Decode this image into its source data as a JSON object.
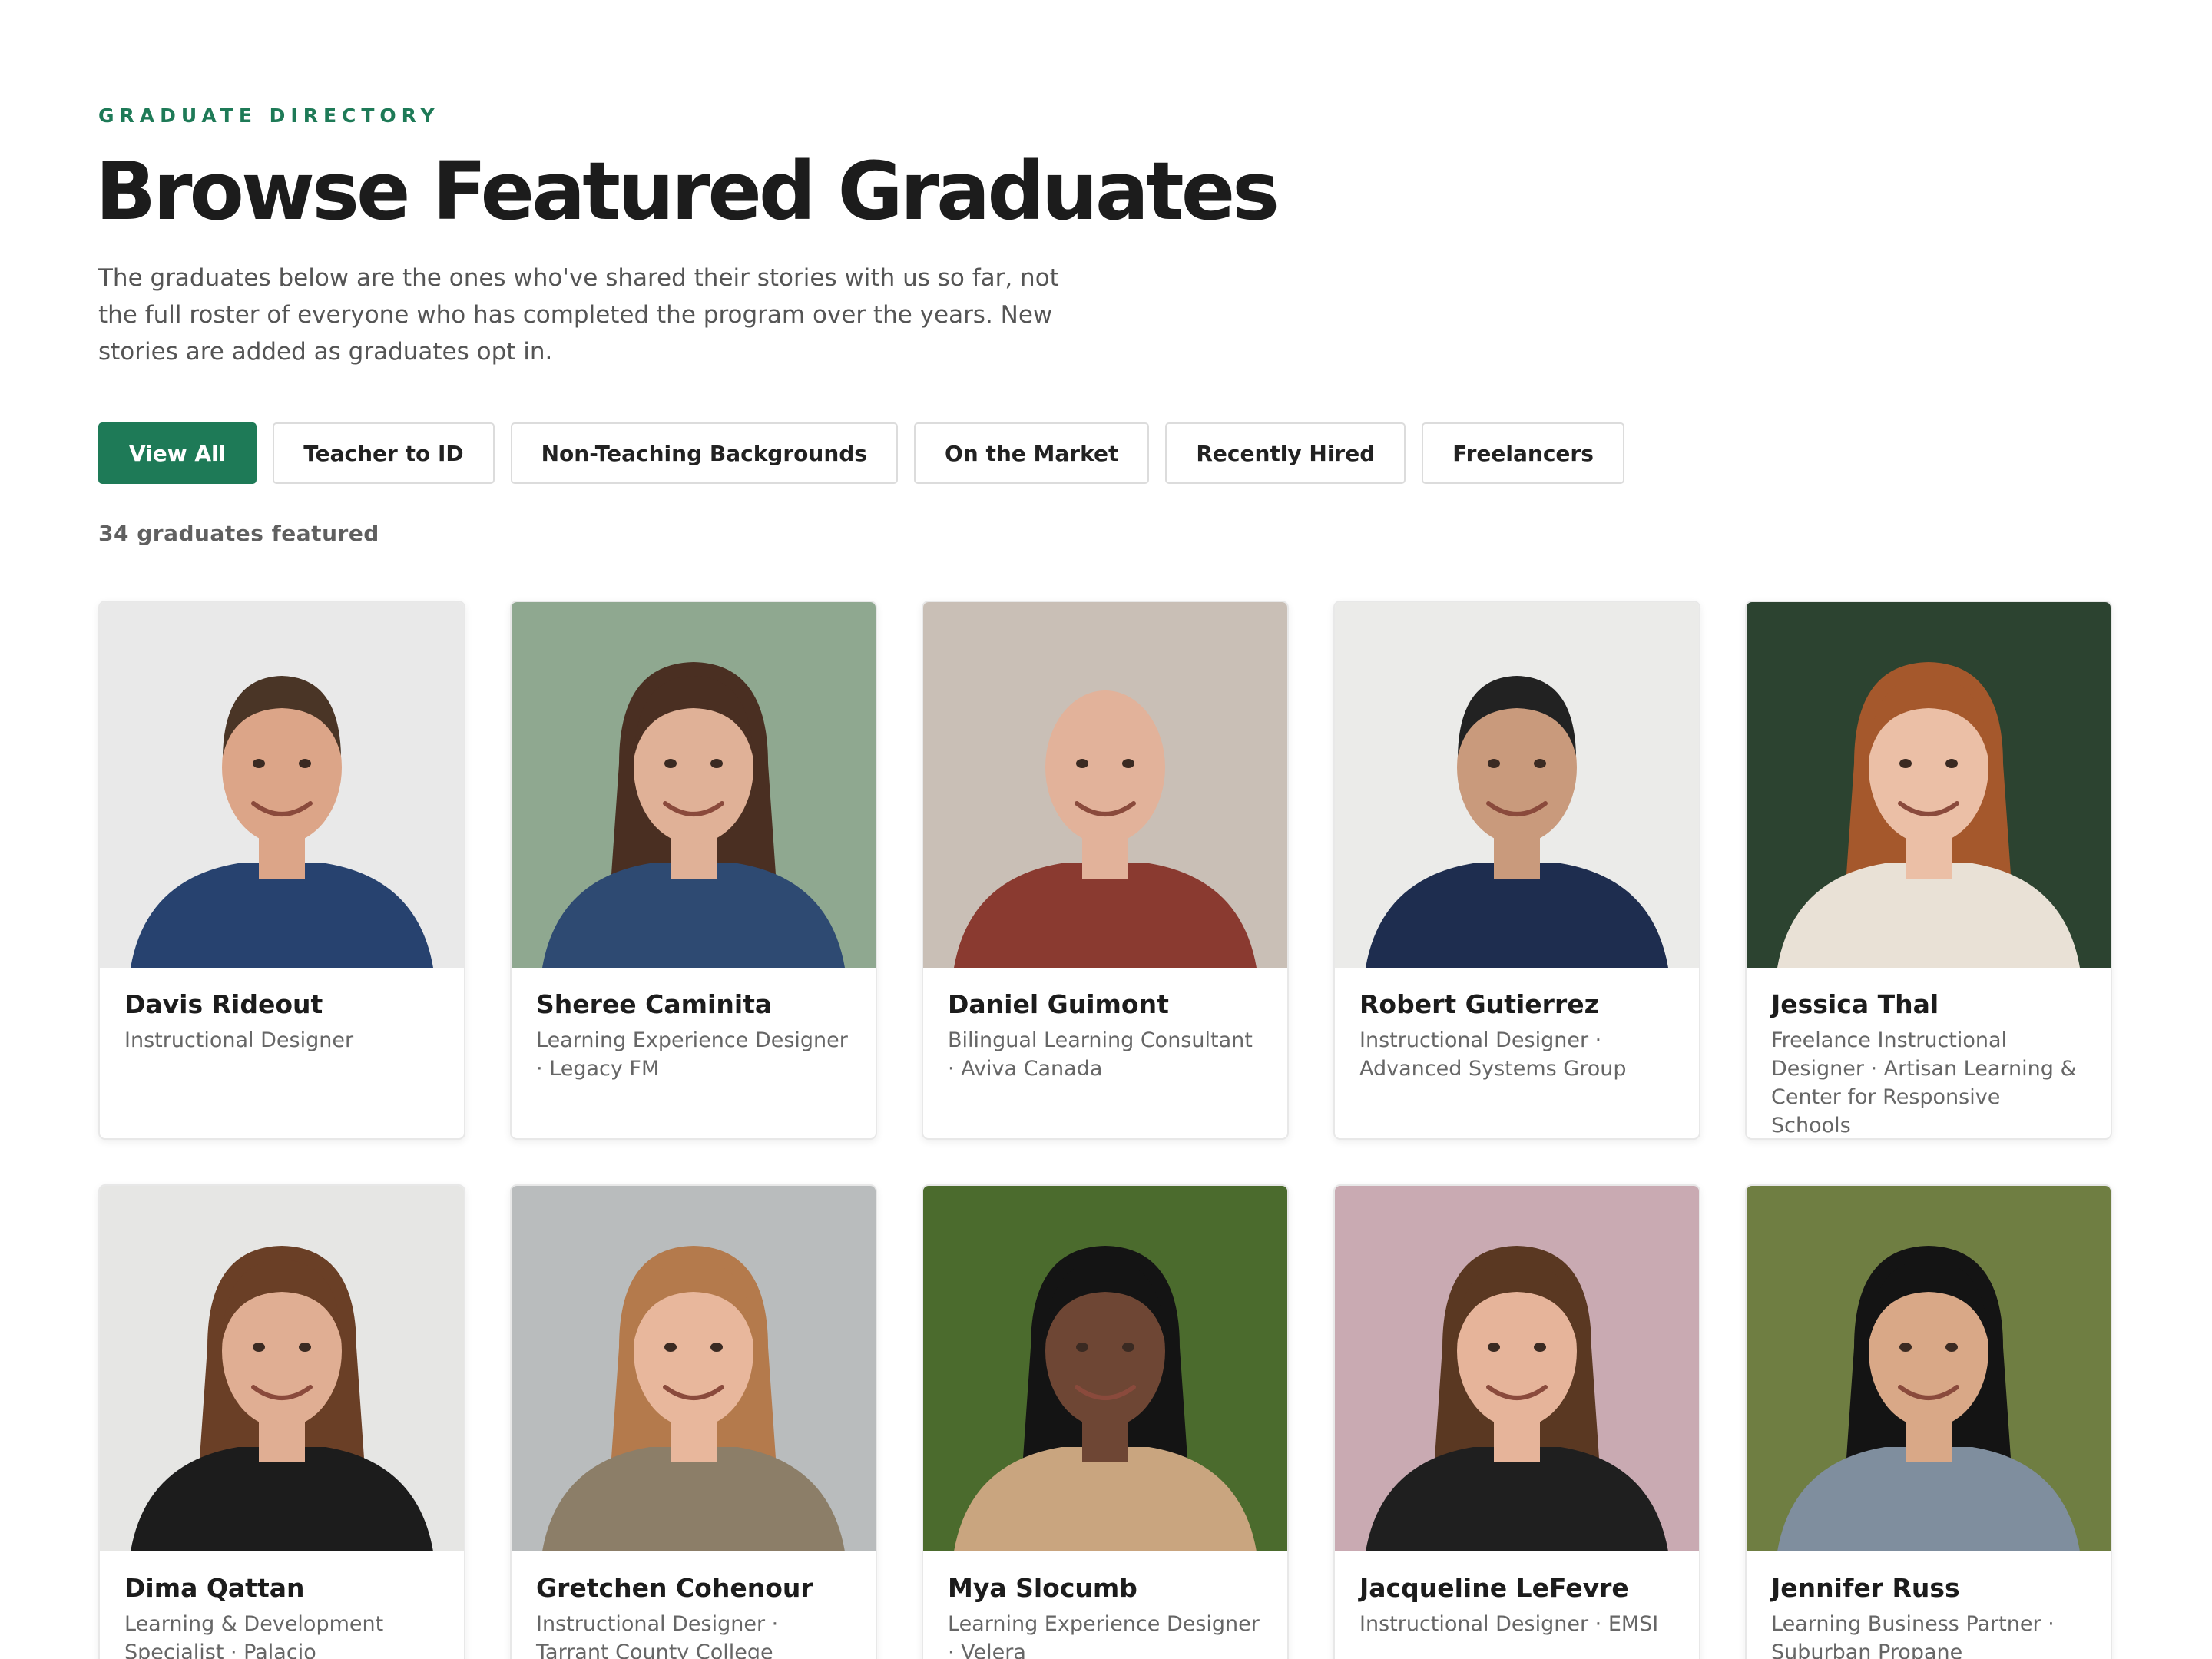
{
  "header": {
    "eyebrow": "GRADUATE DIRECTORY",
    "title": "Browse Featured Graduates",
    "intro": "The graduates below are the ones who've shared their stories with us so far, not the full roster of everyone who has completed the program over the years. New stories are added as graduates opt in."
  },
  "filters": [
    {
      "label": "View All",
      "active": true
    },
    {
      "label": "Teacher to ID",
      "active": false
    },
    {
      "label": "Non-Teaching Backgrounds",
      "active": false
    },
    {
      "label": "On the Market",
      "active": false
    },
    {
      "label": "Recently Hired",
      "active": false
    },
    {
      "label": "Freelancers",
      "active": false
    }
  ],
  "count_label": "34 graduates featured",
  "colors": {
    "accent": "#1e7a57"
  },
  "graduates": [
    {
      "name": "Davis Rideout",
      "role": "Instructional Designer",
      "bg": "#e9e9e9",
      "skin": "#dca588",
      "hair": "#4a3526",
      "shirt": "#27426f",
      "hair_style": "short"
    },
    {
      "name": "Sheree Caminita",
      "role": "Learning Experience Designer · Legacy FM",
      "bg": "#8fa890",
      "skin": "#e0b197",
      "hair": "#4a2f22",
      "shirt": "#2e4a72",
      "hair_style": "long"
    },
    {
      "name": "Daniel Guimont",
      "role": "Bilingual Learning Consultant · Aviva Canada",
      "bg": "#c9bfb6",
      "skin": "#e2b29a",
      "hair": "#d8a991",
      "shirt": "#8a3a30",
      "hair_style": "bald"
    },
    {
      "name": "Robert Gutierrez",
      "role": "Instructional Designer · Advanced Systems Group",
      "bg": "#ebebe9",
      "skin": "#c99a7c",
      "hair": "#222222",
      "shirt": "#1e2d4f",
      "hair_style": "short"
    },
    {
      "name": "Jessica Thal",
      "role": "Freelance Instructional Designer · Artisan Learning & Center for Responsive Schools",
      "bg": "#2c4330",
      "skin": "#ebbfa6",
      "hair": "#a5582c",
      "shirt": "#e9e1d6",
      "hair_style": "long"
    },
    {
      "name": "Dima Qattan",
      "role": "Learning & Development Specialist · Palacio",
      "bg": "#e6e6e4",
      "skin": "#e0ae93",
      "hair": "#6a3f26",
      "shirt": "#1c1c1c",
      "hair_style": "long"
    },
    {
      "name": "Gretchen Cohenour",
      "role": "Instructional Designer · Tarrant County College",
      "bg": "#b9bcbd",
      "skin": "#e8b79c",
      "hair": "#b47a4c",
      "shirt": "#8c7e68",
      "hair_style": "long"
    },
    {
      "name": "Mya Slocumb",
      "role": "Learning Experience Designer · Velera",
      "bg": "#4b6b2d",
      "skin": "#6e4634",
      "hair": "#141414",
      "shirt": "#c9a57f",
      "hair_style": "long"
    },
    {
      "name": "Jacqueline LeFevre",
      "role": "Instructional Designer · EMSI",
      "bg": "#c9aab2",
      "skin": "#e6b49a",
      "hair": "#5a3822",
      "shirt": "#1f1f1f",
      "hair_style": "long"
    },
    {
      "name": "Jennifer Russ",
      "role": "Learning Business Partner · Suburban Propane",
      "bg": "#6f7e42",
      "skin": "#d9a887",
      "hair": "#141414",
      "shirt": "#7f8e9e",
      "hair_style": "long"
    }
  ]
}
